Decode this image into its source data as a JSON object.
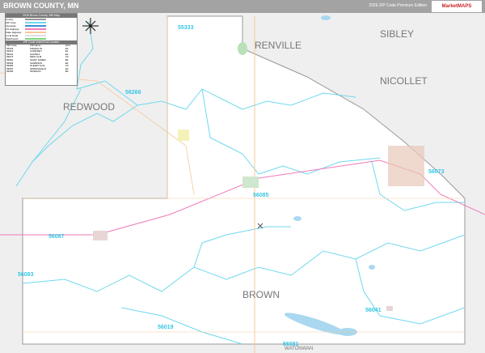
{
  "header": {
    "title": "BROWN COUNTY, MN",
    "edition": "2026 ZIP Code Premium Edition",
    "logo_text": "MarketMAPS"
  },
  "legend": {
    "title": "2026 Brown County, MN Map",
    "items": [
      {
        "label": "County",
        "color": "#999999"
      },
      {
        "label": "ZIP Code",
        "color": "#6fd8ee"
      },
      {
        "label": "Interstate",
        "color": "#3a8fd8"
      },
      {
        "label": "US Highway",
        "color": "#f07ab8"
      },
      {
        "label": "State Highway",
        "color": "#f5c99a"
      },
      {
        "label": "Local Road",
        "color": "#dddddd"
      },
      {
        "label": "Park/Forest",
        "color": "#7bd37b"
      }
    ],
    "grid_title": "ZIP Code Index/Grid Locator",
    "grid_headers": [
      "ZIP Code",
      "ZIP Name",
      "Grid"
    ],
    "grid_rows": [
      [
        "55333",
        "FRANKLIN",
        "D1"
      ],
      [
        "56019",
        "COMFREY",
        "E1"
      ],
      [
        "56041",
        "HANSKA",
        "E2"
      ],
      [
        "56073",
        "NEW ULM",
        "C3"
      ],
      [
        "56081",
        "SAINT JAMES",
        "B4"
      ],
      [
        "56083",
        "SANBORN",
        "E4"
      ],
      [
        "56085",
        "SLEEPY EYE",
        "C3"
      ],
      [
        "56087",
        "SPRINGFIELD",
        "D2"
      ],
      [
        "56266",
        "MORGAN",
        "B2"
      ]
    ]
  },
  "map": {
    "county_labels": [
      "RENVILLE",
      "SIBLEY",
      "NICOLLET",
      "REDWOOD",
      "BROWN",
      "WATONWAN"
    ],
    "zip_labels": [
      "55333",
      "56266",
      "56085",
      "56073",
      "56087",
      "56083",
      "56019",
      "56081",
      "56041"
    ],
    "colors": {
      "zip_boundary": "#6fd8ee",
      "highway": "#f07ab8",
      "state_road": "#f5c99a",
      "outside": "#efefef",
      "water": "#a9d8f0"
    }
  }
}
